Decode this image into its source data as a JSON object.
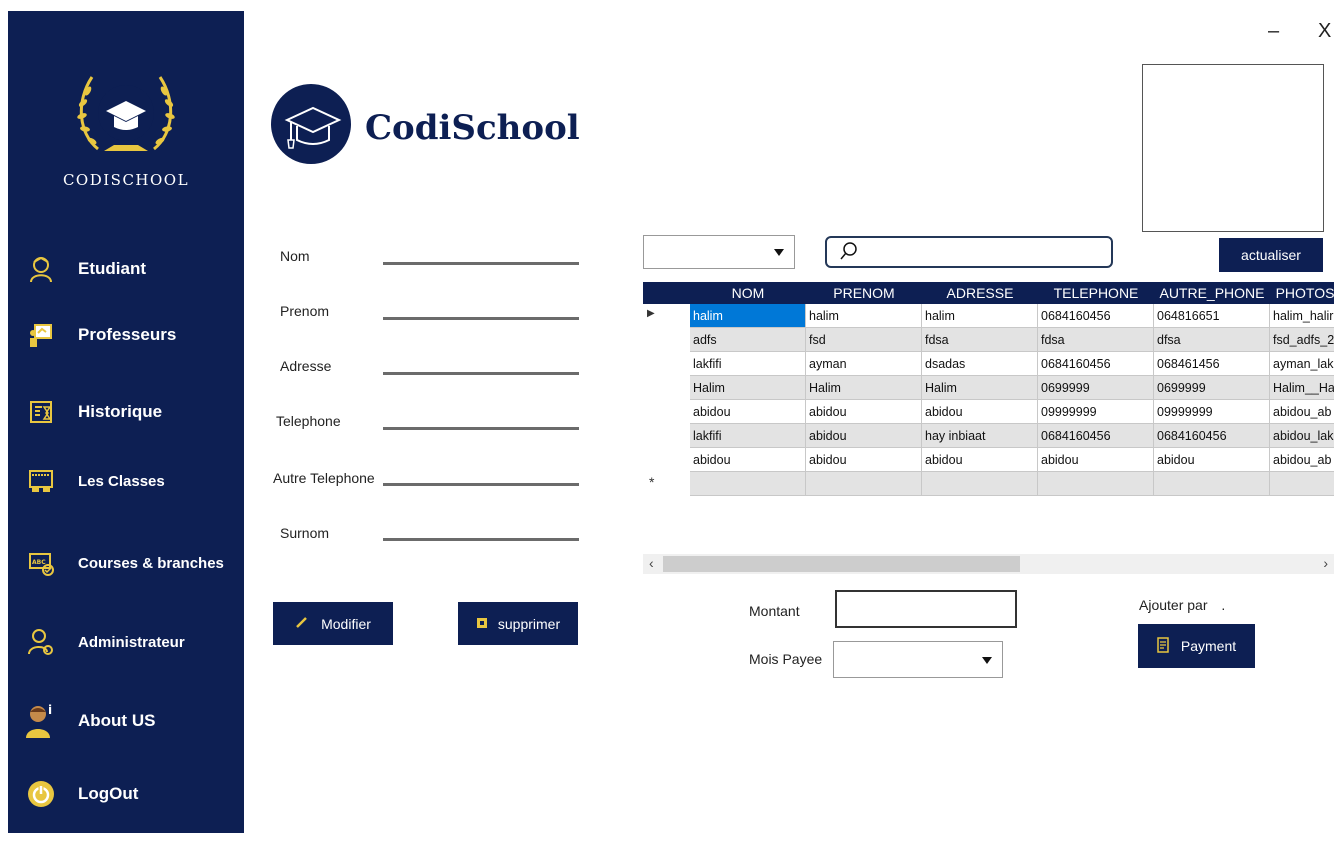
{
  "window": {
    "minimize_label": "–",
    "close_label": "X"
  },
  "sidebar": {
    "brand": "CODISCHOOL",
    "items": [
      {
        "label": "Etudiant",
        "icon": "student-icon"
      },
      {
        "label": "Professeurs",
        "icon": "teacher-icon"
      },
      {
        "label": "Historique",
        "icon": "history-icon"
      },
      {
        "label": "Les Classes",
        "icon": "classroom-icon"
      },
      {
        "label": "Courses & branches",
        "icon": "courses-icon"
      },
      {
        "label": "Administrateur",
        "icon": "admin-icon"
      },
      {
        "label": "About US",
        "icon": "about-icon"
      },
      {
        "label": "LogOut",
        "icon": "power-icon"
      }
    ]
  },
  "header": {
    "title": "CodiSchool"
  },
  "form": {
    "fields": [
      {
        "label": "Nom"
      },
      {
        "label": "Prenom"
      },
      {
        "label": "Adresse"
      },
      {
        "label": "Telephone"
      },
      {
        "label": "Autre Telephone"
      },
      {
        "label": "Surnom"
      }
    ],
    "modify_label": "Modifier",
    "delete_label": "supprimer"
  },
  "toolbar": {
    "refresh_label": "actualiser"
  },
  "grid": {
    "columns": [
      "NOM",
      "PRENOM",
      "ADRESSE",
      "TELEPHONE",
      "AUTRE_PHONE",
      "PHOTOS"
    ],
    "rows": [
      [
        "halim",
        "halim",
        "halim",
        "0684160456",
        "064816651",
        "halim_halir"
      ],
      [
        "adfs",
        "fsd",
        "fdsa",
        "fdsa",
        "dfsa",
        "fsd_adfs_2"
      ],
      [
        "lakfifi",
        "ayman",
        "dsadas",
        "0684160456",
        "068461456",
        "ayman_lak"
      ],
      [
        "Halim",
        "Halim",
        "Halim",
        "0699999",
        "0699999",
        "Halim__Ha"
      ],
      [
        "abidou",
        "abidou",
        "abidou",
        "09999999",
        "09999999",
        "abidou_ab"
      ],
      [
        "lakfifi",
        "abidou",
        "hay inbiaat",
        "0684160456",
        "0684160456",
        "abidou_lak"
      ],
      [
        "abidou",
        "abidou",
        "abidou",
        "abidou",
        "abidou",
        "abidou_ab"
      ]
    ],
    "new_row_marker": "*",
    "selected_marker": "▶"
  },
  "payment": {
    "amount_label": "Montant",
    "month_label": "Mois Payee",
    "added_by_label": "Ajouter par",
    "added_by_value": ".",
    "button_label": "Payment"
  },
  "colors": {
    "navy": "#0d1f53",
    "gold": "#e8c640",
    "selection": "#0078d7"
  }
}
